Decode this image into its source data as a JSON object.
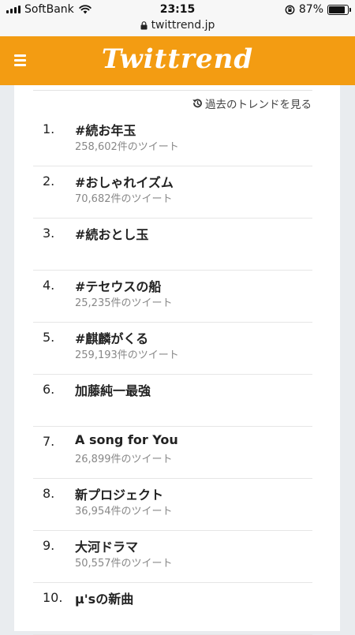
{
  "status_bar": {
    "carrier": "SoftBank",
    "time": "23:15",
    "battery_percent": "87%",
    "battery_level": 0.87,
    "url": "twittrend.jp"
  },
  "header": {
    "logo": "Twittrend",
    "menu_icon": "hamburger-icon"
  },
  "past_trends_link": "過去のトレンドを見る",
  "trends": [
    {
      "rank": "1.",
      "keyword": "#続お年玉",
      "tweets": "258,602件のツイート"
    },
    {
      "rank": "2.",
      "keyword": "#おしゃれイズム",
      "tweets": "70,682件のツイート"
    },
    {
      "rank": "3.",
      "keyword": "#続おとし玉",
      "tweets": ""
    },
    {
      "rank": "4.",
      "keyword": "#テセウスの船",
      "tweets": "25,235件のツイート"
    },
    {
      "rank": "5.",
      "keyword": "#麒麟がくる",
      "tweets": "259,193件のツイート"
    },
    {
      "rank": "6.",
      "keyword": "加藤純一最強",
      "tweets": ""
    },
    {
      "rank": "7.",
      "keyword": "A song for You",
      "tweets": "26,899件のツイート"
    },
    {
      "rank": "8.",
      "keyword": "新プロジェクト",
      "tweets": "36,954件のツイート"
    },
    {
      "rank": "9.",
      "keyword": "大河ドラマ",
      "tweets": "50,557件のツイート"
    },
    {
      "rank": "10.",
      "keyword": "μ'sの新曲",
      "tweets": ""
    }
  ],
  "colors": {
    "header": "#f39c12",
    "background": "#e9ecef"
  }
}
